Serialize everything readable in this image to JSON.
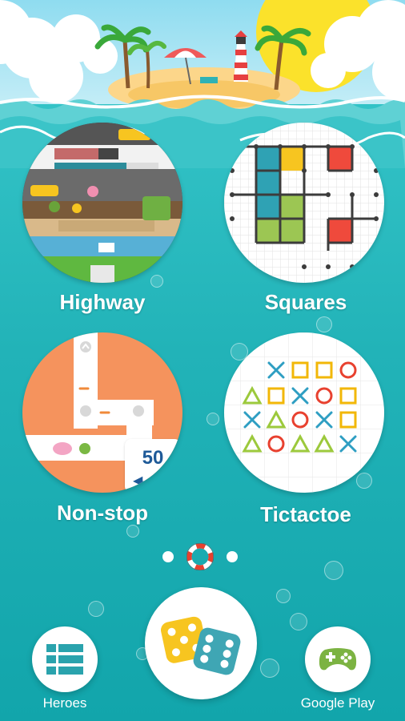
{
  "games": [
    {
      "id": "highway",
      "label": "Highway"
    },
    {
      "id": "squares",
      "label": "Squares"
    },
    {
      "id": "nonstop",
      "label": "Non-stop",
      "score": "50"
    },
    {
      "id": "tictactoe",
      "label": "Tictactoe"
    }
  ],
  "pager": {
    "total": 3,
    "active": 1
  },
  "bottom_nav": {
    "heroes_label": "Heroes",
    "play_icon": "dice-icon",
    "google_play_label": "Google Play"
  },
  "colors": {
    "sea": "#22b3b8",
    "nonstop_bg": "#f5935d",
    "squares_blue": "#2fa2b4",
    "squares_yellow": "#f7c520",
    "squares_green": "#9cc653",
    "squares_red": "#ef4a3c",
    "ttt_blue": "#2e9ec2",
    "ttt_yellow": "#f2b707",
    "ttt_red": "#e8412f",
    "ttt_green": "#9cc93c"
  }
}
